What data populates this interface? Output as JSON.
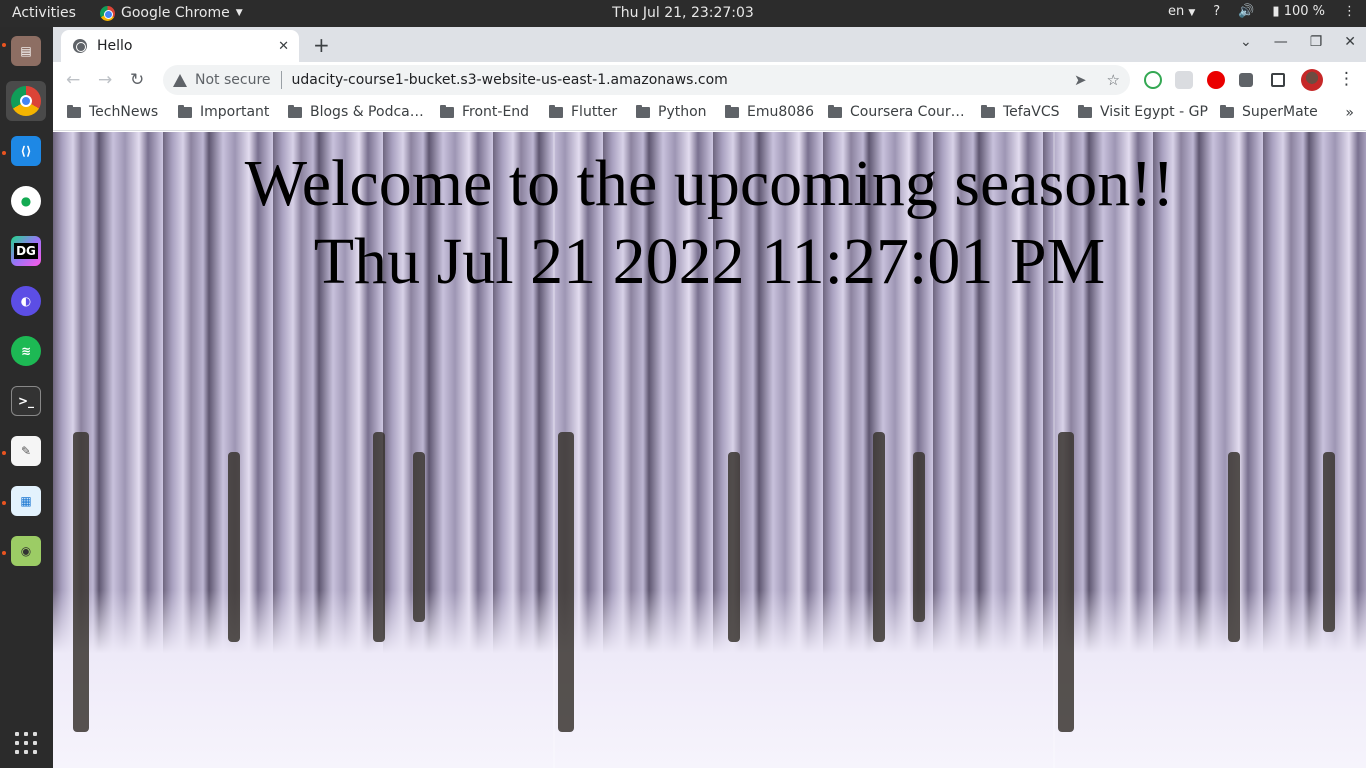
{
  "topbar": {
    "activities": "Activities",
    "app_name": "Google Chrome",
    "clock": "Thu Jul 21, 23:27:03",
    "lang": "en",
    "help": "?",
    "battery": "100 %"
  },
  "dock": {
    "items": [
      {
        "name": "files",
        "label": "",
        "color": "#8d6e63"
      },
      {
        "name": "chrome",
        "label": "",
        "color": "#4285f4"
      },
      {
        "name": "vscode",
        "label": "",
        "color": "#1e88e5"
      },
      {
        "name": "mongodb-compass",
        "label": "",
        "color": "#13aa52"
      },
      {
        "name": "datagrip",
        "label": "DG",
        "color": "#21d789"
      },
      {
        "name": "eclipse",
        "label": "",
        "color": "#5c4ee5"
      },
      {
        "name": "spotify",
        "label": "",
        "color": "#1db954"
      },
      {
        "name": "terminal",
        "label": ">_",
        "color": "#333333"
      },
      {
        "name": "text-editor",
        "label": "",
        "color": "#f5f5f5"
      },
      {
        "name": "document-viewer",
        "label": "",
        "color": "#1976d2"
      },
      {
        "name": "screenshot-tool",
        "label": "",
        "color": "#9ccc65"
      }
    ]
  },
  "browser": {
    "tab_title": "Hello",
    "tab_close": "✕",
    "new_tab": "+",
    "not_secure": "Not secure",
    "url": "udacity-course1-bucket.s3-website-us-east-1.amazonaws.com",
    "bookmarks": [
      "TechNews",
      "Important",
      "Blogs & Podca…",
      "Front-End",
      "Flutter",
      "Python",
      "Emu8086",
      "Coursera Cour…",
      "TefaVCS",
      "Visit Egypt - GP",
      "SuperMate"
    ],
    "bookmarks_more": "»"
  },
  "page": {
    "heading": "Welcome to the upcoming season!!",
    "datetime": "Thu Jul 21 2022 11:27:01 PM"
  },
  "colors": {
    "topbar_bg": "#2c2c2c",
    "dock_bg": "#2b2b2b",
    "tabstrip_bg": "#dee1e6",
    "omnibox_bg": "#f1f3f4",
    "snow_accent": "#b7afcc"
  }
}
